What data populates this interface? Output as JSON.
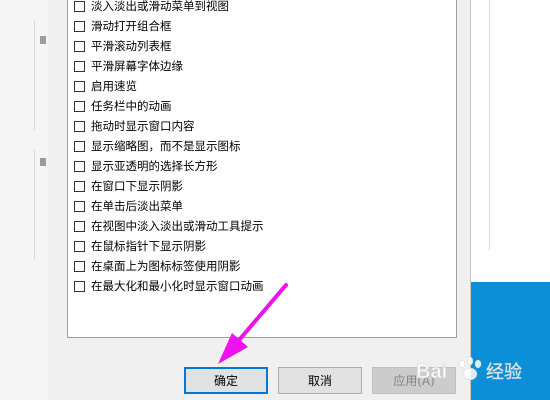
{
  "options": [
    {
      "label": "淡入淡出或滑动菜单到视图",
      "checked": false
    },
    {
      "label": "滑动打开组合框",
      "checked": false
    },
    {
      "label": "平滑滚动列表框",
      "checked": false
    },
    {
      "label": "平滑屏幕字体边缘",
      "checked": false
    },
    {
      "label": "启用速览",
      "checked": false
    },
    {
      "label": "任务栏中的动画",
      "checked": false
    },
    {
      "label": "拖动时显示窗口内容",
      "checked": false
    },
    {
      "label": "显示缩略图，而不是显示图标",
      "checked": false
    },
    {
      "label": "显示亚透明的选择长方形",
      "checked": false
    },
    {
      "label": "在窗口下显示阴影",
      "checked": false
    },
    {
      "label": "在单击后淡出菜单",
      "checked": false
    },
    {
      "label": "在视图中淡入淡出或滑动工具提示",
      "checked": false
    },
    {
      "label": "在鼠标指针下显示阴影",
      "checked": false
    },
    {
      "label": "在桌面上为图标标签使用阴影",
      "checked": false
    },
    {
      "label": "在最大化和最小化时显示窗口动画",
      "checked": false
    }
  ],
  "buttons": {
    "ok": "确定",
    "cancel": "取消",
    "apply": "应用(A)"
  },
  "colors": {
    "annotation_arrow": "#ee11ee",
    "ok_focus_border": "#0078d7",
    "desktop": "#0a8fd8"
  },
  "watermark": {
    "brand": "Bai",
    "sub": "经验"
  }
}
